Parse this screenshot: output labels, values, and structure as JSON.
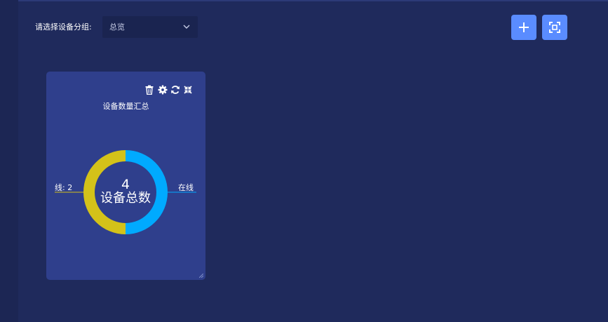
{
  "header": {
    "group_label": "请选择设备分组:",
    "group_select": {
      "value": "总览"
    }
  },
  "toolbar": {
    "add_icon": "plus-icon",
    "fullscreen_icon": "fullscreen-icon"
  },
  "widget": {
    "title": "设备数量汇总",
    "icons": [
      "trash-icon",
      "gear-icon",
      "refresh-icon",
      "collapse-icon"
    ],
    "center_value": "4",
    "center_label": "设备总数",
    "label_left": "线: 2",
    "label_right": "在线"
  },
  "chart_data": {
    "type": "pie",
    "title": "设备数量汇总",
    "categories": [
      "在线",
      "离线"
    ],
    "values": [
      2,
      2
    ],
    "colors": [
      "#00aaff",
      "#d4c219"
    ],
    "center_text": [
      "4",
      "设备总数"
    ]
  },
  "colors": {
    "page_bg": "#1f2a5c",
    "card_bg": "#2f3f8c",
    "button_bg": "#5a8cff",
    "select_bg": "#1a2450"
  }
}
